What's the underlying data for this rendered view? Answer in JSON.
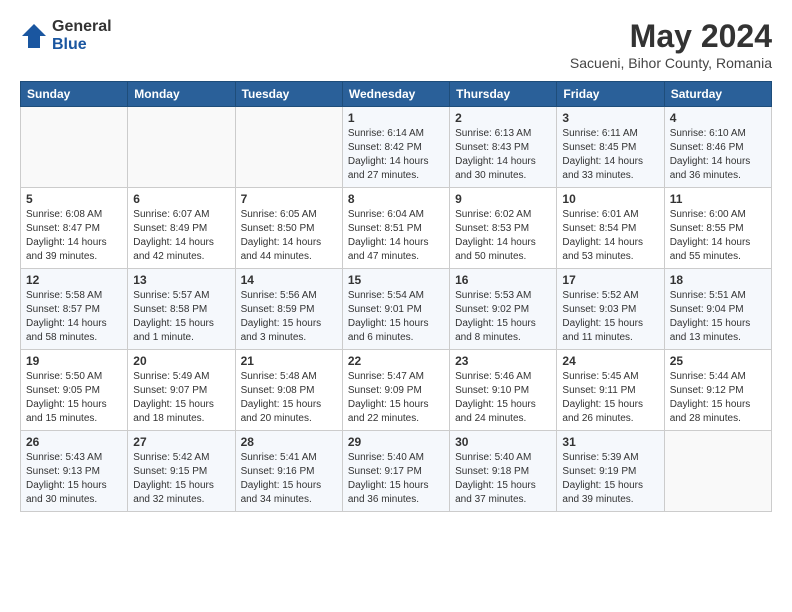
{
  "header": {
    "logo_general": "General",
    "logo_blue": "Blue",
    "month": "May 2024",
    "location": "Sacueni, Bihor County, Romania"
  },
  "days_of_week": [
    "Sunday",
    "Monday",
    "Tuesday",
    "Wednesday",
    "Thursday",
    "Friday",
    "Saturday"
  ],
  "weeks": [
    [
      {
        "day": "",
        "info": ""
      },
      {
        "day": "",
        "info": ""
      },
      {
        "day": "",
        "info": ""
      },
      {
        "day": "1",
        "info": "Sunrise: 6:14 AM\nSunset: 8:42 PM\nDaylight: 14 hours\nand 27 minutes."
      },
      {
        "day": "2",
        "info": "Sunrise: 6:13 AM\nSunset: 8:43 PM\nDaylight: 14 hours\nand 30 minutes."
      },
      {
        "day": "3",
        "info": "Sunrise: 6:11 AM\nSunset: 8:45 PM\nDaylight: 14 hours\nand 33 minutes."
      },
      {
        "day": "4",
        "info": "Sunrise: 6:10 AM\nSunset: 8:46 PM\nDaylight: 14 hours\nand 36 minutes."
      }
    ],
    [
      {
        "day": "5",
        "info": "Sunrise: 6:08 AM\nSunset: 8:47 PM\nDaylight: 14 hours\nand 39 minutes."
      },
      {
        "day": "6",
        "info": "Sunrise: 6:07 AM\nSunset: 8:49 PM\nDaylight: 14 hours\nand 42 minutes."
      },
      {
        "day": "7",
        "info": "Sunrise: 6:05 AM\nSunset: 8:50 PM\nDaylight: 14 hours\nand 44 minutes."
      },
      {
        "day": "8",
        "info": "Sunrise: 6:04 AM\nSunset: 8:51 PM\nDaylight: 14 hours\nand 47 minutes."
      },
      {
        "day": "9",
        "info": "Sunrise: 6:02 AM\nSunset: 8:53 PM\nDaylight: 14 hours\nand 50 minutes."
      },
      {
        "day": "10",
        "info": "Sunrise: 6:01 AM\nSunset: 8:54 PM\nDaylight: 14 hours\nand 53 minutes."
      },
      {
        "day": "11",
        "info": "Sunrise: 6:00 AM\nSunset: 8:55 PM\nDaylight: 14 hours\nand 55 minutes."
      }
    ],
    [
      {
        "day": "12",
        "info": "Sunrise: 5:58 AM\nSunset: 8:57 PM\nDaylight: 14 hours\nand 58 minutes."
      },
      {
        "day": "13",
        "info": "Sunrise: 5:57 AM\nSunset: 8:58 PM\nDaylight: 15 hours\nand 1 minute."
      },
      {
        "day": "14",
        "info": "Sunrise: 5:56 AM\nSunset: 8:59 PM\nDaylight: 15 hours\nand 3 minutes."
      },
      {
        "day": "15",
        "info": "Sunrise: 5:54 AM\nSunset: 9:01 PM\nDaylight: 15 hours\nand 6 minutes."
      },
      {
        "day": "16",
        "info": "Sunrise: 5:53 AM\nSunset: 9:02 PM\nDaylight: 15 hours\nand 8 minutes."
      },
      {
        "day": "17",
        "info": "Sunrise: 5:52 AM\nSunset: 9:03 PM\nDaylight: 15 hours\nand 11 minutes."
      },
      {
        "day": "18",
        "info": "Sunrise: 5:51 AM\nSunset: 9:04 PM\nDaylight: 15 hours\nand 13 minutes."
      }
    ],
    [
      {
        "day": "19",
        "info": "Sunrise: 5:50 AM\nSunset: 9:05 PM\nDaylight: 15 hours\nand 15 minutes."
      },
      {
        "day": "20",
        "info": "Sunrise: 5:49 AM\nSunset: 9:07 PM\nDaylight: 15 hours\nand 18 minutes."
      },
      {
        "day": "21",
        "info": "Sunrise: 5:48 AM\nSunset: 9:08 PM\nDaylight: 15 hours\nand 20 minutes."
      },
      {
        "day": "22",
        "info": "Sunrise: 5:47 AM\nSunset: 9:09 PM\nDaylight: 15 hours\nand 22 minutes."
      },
      {
        "day": "23",
        "info": "Sunrise: 5:46 AM\nSunset: 9:10 PM\nDaylight: 15 hours\nand 24 minutes."
      },
      {
        "day": "24",
        "info": "Sunrise: 5:45 AM\nSunset: 9:11 PM\nDaylight: 15 hours\nand 26 minutes."
      },
      {
        "day": "25",
        "info": "Sunrise: 5:44 AM\nSunset: 9:12 PM\nDaylight: 15 hours\nand 28 minutes."
      }
    ],
    [
      {
        "day": "26",
        "info": "Sunrise: 5:43 AM\nSunset: 9:13 PM\nDaylight: 15 hours\nand 30 minutes."
      },
      {
        "day": "27",
        "info": "Sunrise: 5:42 AM\nSunset: 9:15 PM\nDaylight: 15 hours\nand 32 minutes."
      },
      {
        "day": "28",
        "info": "Sunrise: 5:41 AM\nSunset: 9:16 PM\nDaylight: 15 hours\nand 34 minutes."
      },
      {
        "day": "29",
        "info": "Sunrise: 5:40 AM\nSunset: 9:17 PM\nDaylight: 15 hours\nand 36 minutes."
      },
      {
        "day": "30",
        "info": "Sunrise: 5:40 AM\nSunset: 9:18 PM\nDaylight: 15 hours\nand 37 minutes."
      },
      {
        "day": "31",
        "info": "Sunrise: 5:39 AM\nSunset: 9:19 PM\nDaylight: 15 hours\nand 39 minutes."
      },
      {
        "day": "",
        "info": ""
      }
    ]
  ]
}
